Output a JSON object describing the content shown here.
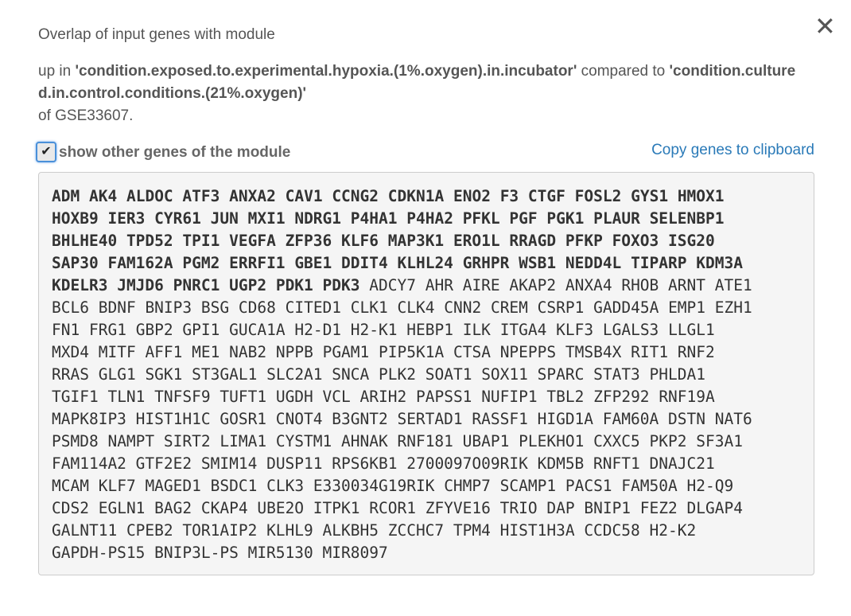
{
  "dialog": {
    "close_glyph": "✕",
    "title": "Overlap of input genes with module",
    "desc_prefix": "up in ",
    "condition_a": "'condition.exposed.to.experimental.hypoxia.(1%.oxygen).in.incubator'",
    "desc_mid": " compared to ",
    "condition_b": "'condition.cultured.in.control.conditions.(21%.oxygen)'",
    "dataset": "of GSE33607.",
    "checkbox_label": "show other genes of the module",
    "checkbox_checked": true,
    "copy_link": "Copy genes to clipboard"
  },
  "genes": {
    "lines": [
      [
        [
          "ADM",
          1
        ],
        [
          "AK4",
          1
        ],
        [
          "ALDOC",
          1
        ],
        [
          "ATF3",
          1
        ],
        [
          "ANXA2",
          1
        ],
        [
          "CAV1",
          1
        ],
        [
          "CCNG2",
          1
        ],
        [
          "CDKN1A",
          1
        ],
        [
          "ENO2",
          1
        ],
        [
          "F3",
          1
        ],
        [
          "CTGF",
          1
        ],
        [
          "FOSL2",
          1
        ],
        [
          "GYS1",
          1
        ],
        [
          "HMOX1",
          1
        ]
      ],
      [
        [
          "HOXB9",
          1
        ],
        [
          "IER3",
          1
        ],
        [
          "CYR61",
          1
        ],
        [
          "JUN",
          1
        ],
        [
          "MXI1",
          1
        ],
        [
          "NDRG1",
          1
        ],
        [
          "P4HA1",
          1
        ],
        [
          "P4HA2",
          1
        ],
        [
          "PFKL",
          1
        ],
        [
          "PGF",
          1
        ],
        [
          "PGK1",
          1
        ],
        [
          "PLAUR",
          1
        ],
        [
          "SELENBP1",
          1
        ]
      ],
      [
        [
          "BHLHE40",
          1
        ],
        [
          "TPD52",
          1
        ],
        [
          "TPI1",
          1
        ],
        [
          "VEGFA",
          1
        ],
        [
          "ZFP36",
          1
        ],
        [
          "KLF6",
          1
        ],
        [
          "MAP3K1",
          1
        ],
        [
          "ERO1L",
          1
        ],
        [
          "RRAGD",
          1
        ],
        [
          "PFKP",
          1
        ],
        [
          "FOXO3",
          1
        ],
        [
          "ISG20",
          1
        ]
      ],
      [
        [
          "SAP30",
          1
        ],
        [
          "FAM162A",
          1
        ],
        [
          "PGM2",
          1
        ],
        [
          "ERRFI1",
          1
        ],
        [
          "GBE1",
          1
        ],
        [
          "DDIT4",
          1
        ],
        [
          "KLHL24",
          1
        ],
        [
          "GRHPR",
          1
        ],
        [
          "WSB1",
          1
        ],
        [
          "NEDD4L",
          1
        ],
        [
          "TIPARP",
          1
        ],
        [
          "KDM3A",
          1
        ]
      ],
      [
        [
          "KDELR3",
          1
        ],
        [
          "JMJD6",
          1
        ],
        [
          "PNRC1",
          1
        ],
        [
          "UGP2",
          1
        ],
        [
          "PDK1",
          1
        ],
        [
          "PDK3",
          1
        ],
        [
          "ADCY7",
          0
        ],
        [
          "AHR",
          0
        ],
        [
          "AIRE",
          0
        ],
        [
          "AKAP2",
          0
        ],
        [
          "ANXA4",
          0
        ],
        [
          "RHOB",
          0
        ],
        [
          "ARNT",
          0
        ],
        [
          "ATE1",
          0
        ]
      ],
      [
        [
          "BCL6",
          0
        ],
        [
          "BDNF",
          0
        ],
        [
          "BNIP3",
          0
        ],
        [
          "BSG",
          0
        ],
        [
          "CD68",
          0
        ],
        [
          "CITED1",
          0
        ],
        [
          "CLK1",
          0
        ],
        [
          "CLK4",
          0
        ],
        [
          "CNN2",
          0
        ],
        [
          "CREM",
          0
        ],
        [
          "CSRP1",
          0
        ],
        [
          "GADD45A",
          0
        ],
        [
          "EMP1",
          0
        ],
        [
          "EZH1",
          0
        ]
      ],
      [
        [
          "FN1",
          0
        ],
        [
          "FRG1",
          0
        ],
        [
          "GBP2",
          0
        ],
        [
          "GPI1",
          0
        ],
        [
          "GUCA1A",
          0
        ],
        [
          "H2-D1",
          0
        ],
        [
          "H2-K1",
          0
        ],
        [
          "HEBP1",
          0
        ],
        [
          "ILK",
          0
        ],
        [
          "ITGA4",
          0
        ],
        [
          "KLF3",
          0
        ],
        [
          "LGALS3",
          0
        ],
        [
          "LLGL1",
          0
        ]
      ],
      [
        [
          "MXD4",
          0
        ],
        [
          "MITF",
          0
        ],
        [
          "AFF1",
          0
        ],
        [
          "ME1",
          0
        ],
        [
          "NAB2",
          0
        ],
        [
          "NPPB",
          0
        ],
        [
          "PGAM1",
          0
        ],
        [
          "PIP5K1A",
          0
        ],
        [
          "CTSA",
          0
        ],
        [
          "NPEPPS",
          0
        ],
        [
          "TMSB4X",
          0
        ],
        [
          "RIT1",
          0
        ],
        [
          "RNF2",
          0
        ]
      ],
      [
        [
          "RRAS",
          0
        ],
        [
          "GLG1",
          0
        ],
        [
          "SGK1",
          0
        ],
        [
          "ST3GAL1",
          0
        ],
        [
          "SLC2A1",
          0
        ],
        [
          "SNCA",
          0
        ],
        [
          "PLK2",
          0
        ],
        [
          "SOAT1",
          0
        ],
        [
          "SOX11",
          0
        ],
        [
          "SPARC",
          0
        ],
        [
          "STAT3",
          0
        ],
        [
          "PHLDA1",
          0
        ]
      ],
      [
        [
          "TGIF1",
          0
        ],
        [
          "TLN1",
          0
        ],
        [
          "TNFSF9",
          0
        ],
        [
          "TUFT1",
          0
        ],
        [
          "UGDH",
          0
        ],
        [
          "VCL",
          0
        ],
        [
          "ARIH2",
          0
        ],
        [
          "PAPSS1",
          0
        ],
        [
          "NUFIP1",
          0
        ],
        [
          "TBL2",
          0
        ],
        [
          "ZFP292",
          0
        ],
        [
          "RNF19A",
          0
        ]
      ],
      [
        [
          "MAPK8IP3",
          0
        ],
        [
          "HIST1H1C",
          0
        ],
        [
          "GOSR1",
          0
        ],
        [
          "CNOT4",
          0
        ],
        [
          "B3GNT2",
          0
        ],
        [
          "SERTAD1",
          0
        ],
        [
          "RASSF1",
          0
        ],
        [
          "HIGD1A",
          0
        ],
        [
          "FAM60A",
          0
        ],
        [
          "DSTN",
          0
        ],
        [
          "NAT6",
          0
        ]
      ],
      [
        [
          "PSMD8",
          0
        ],
        [
          "NAMPT",
          0
        ],
        [
          "SIRT2",
          0
        ],
        [
          "LIMA1",
          0
        ],
        [
          "CYSTM1",
          0
        ],
        [
          "AHNAK",
          0
        ],
        [
          "RNF181",
          0
        ],
        [
          "UBAP1",
          0
        ],
        [
          "PLEKHO1",
          0
        ],
        [
          "CXXC5",
          0
        ],
        [
          "PKP2",
          0
        ],
        [
          "SF3A1",
          0
        ]
      ],
      [
        [
          "FAM114A2",
          0
        ],
        [
          "GTF2E2",
          0
        ],
        [
          "SMIM14",
          0
        ],
        [
          "DUSP11",
          0
        ],
        [
          "RPS6KB1",
          0
        ],
        [
          "2700097O09RIK",
          0
        ],
        [
          "KDM5B",
          0
        ],
        [
          "RNFT1",
          0
        ],
        [
          "DNAJC21",
          0
        ]
      ],
      [
        [
          "MCAM",
          0
        ],
        [
          "KLF7",
          0
        ],
        [
          "MAGED1",
          0
        ],
        [
          "BSDC1",
          0
        ],
        [
          "CLK3",
          0
        ],
        [
          "E330034G19RIK",
          0
        ],
        [
          "CHMP7",
          0
        ],
        [
          "SCAMP1",
          0
        ],
        [
          "PACS1",
          0
        ],
        [
          "FAM50A",
          0
        ],
        [
          "H2-Q9",
          0
        ]
      ],
      [
        [
          "CDS2",
          0
        ],
        [
          "EGLN1",
          0
        ],
        [
          "BAG2",
          0
        ],
        [
          "CKAP4",
          0
        ],
        [
          "UBE2O",
          0
        ],
        [
          "ITPK1",
          0
        ],
        [
          "RCOR1",
          0
        ],
        [
          "ZFYVE16",
          0
        ],
        [
          "TRIO",
          0
        ],
        [
          "DAP",
          0
        ],
        [
          "BNIP1",
          0
        ],
        [
          "FEZ2",
          0
        ],
        [
          "DLGAP4",
          0
        ]
      ],
      [
        [
          "GALNT11",
          0
        ],
        [
          "CPEB2",
          0
        ],
        [
          "TOR1AIP2",
          0
        ],
        [
          "KLHL9",
          0
        ],
        [
          "ALKBH5",
          0
        ],
        [
          "ZCCHC7",
          0
        ],
        [
          "TPM4",
          0
        ],
        [
          "HIST1H3A",
          0
        ],
        [
          "CCDC58",
          0
        ],
        [
          "H2-K2",
          0
        ]
      ],
      [
        [
          "GAPDH-PS15",
          0
        ],
        [
          "BNIP3L-PS",
          0
        ],
        [
          "MIR5130",
          0
        ],
        [
          "MIR8097",
          0
        ]
      ]
    ]
  }
}
